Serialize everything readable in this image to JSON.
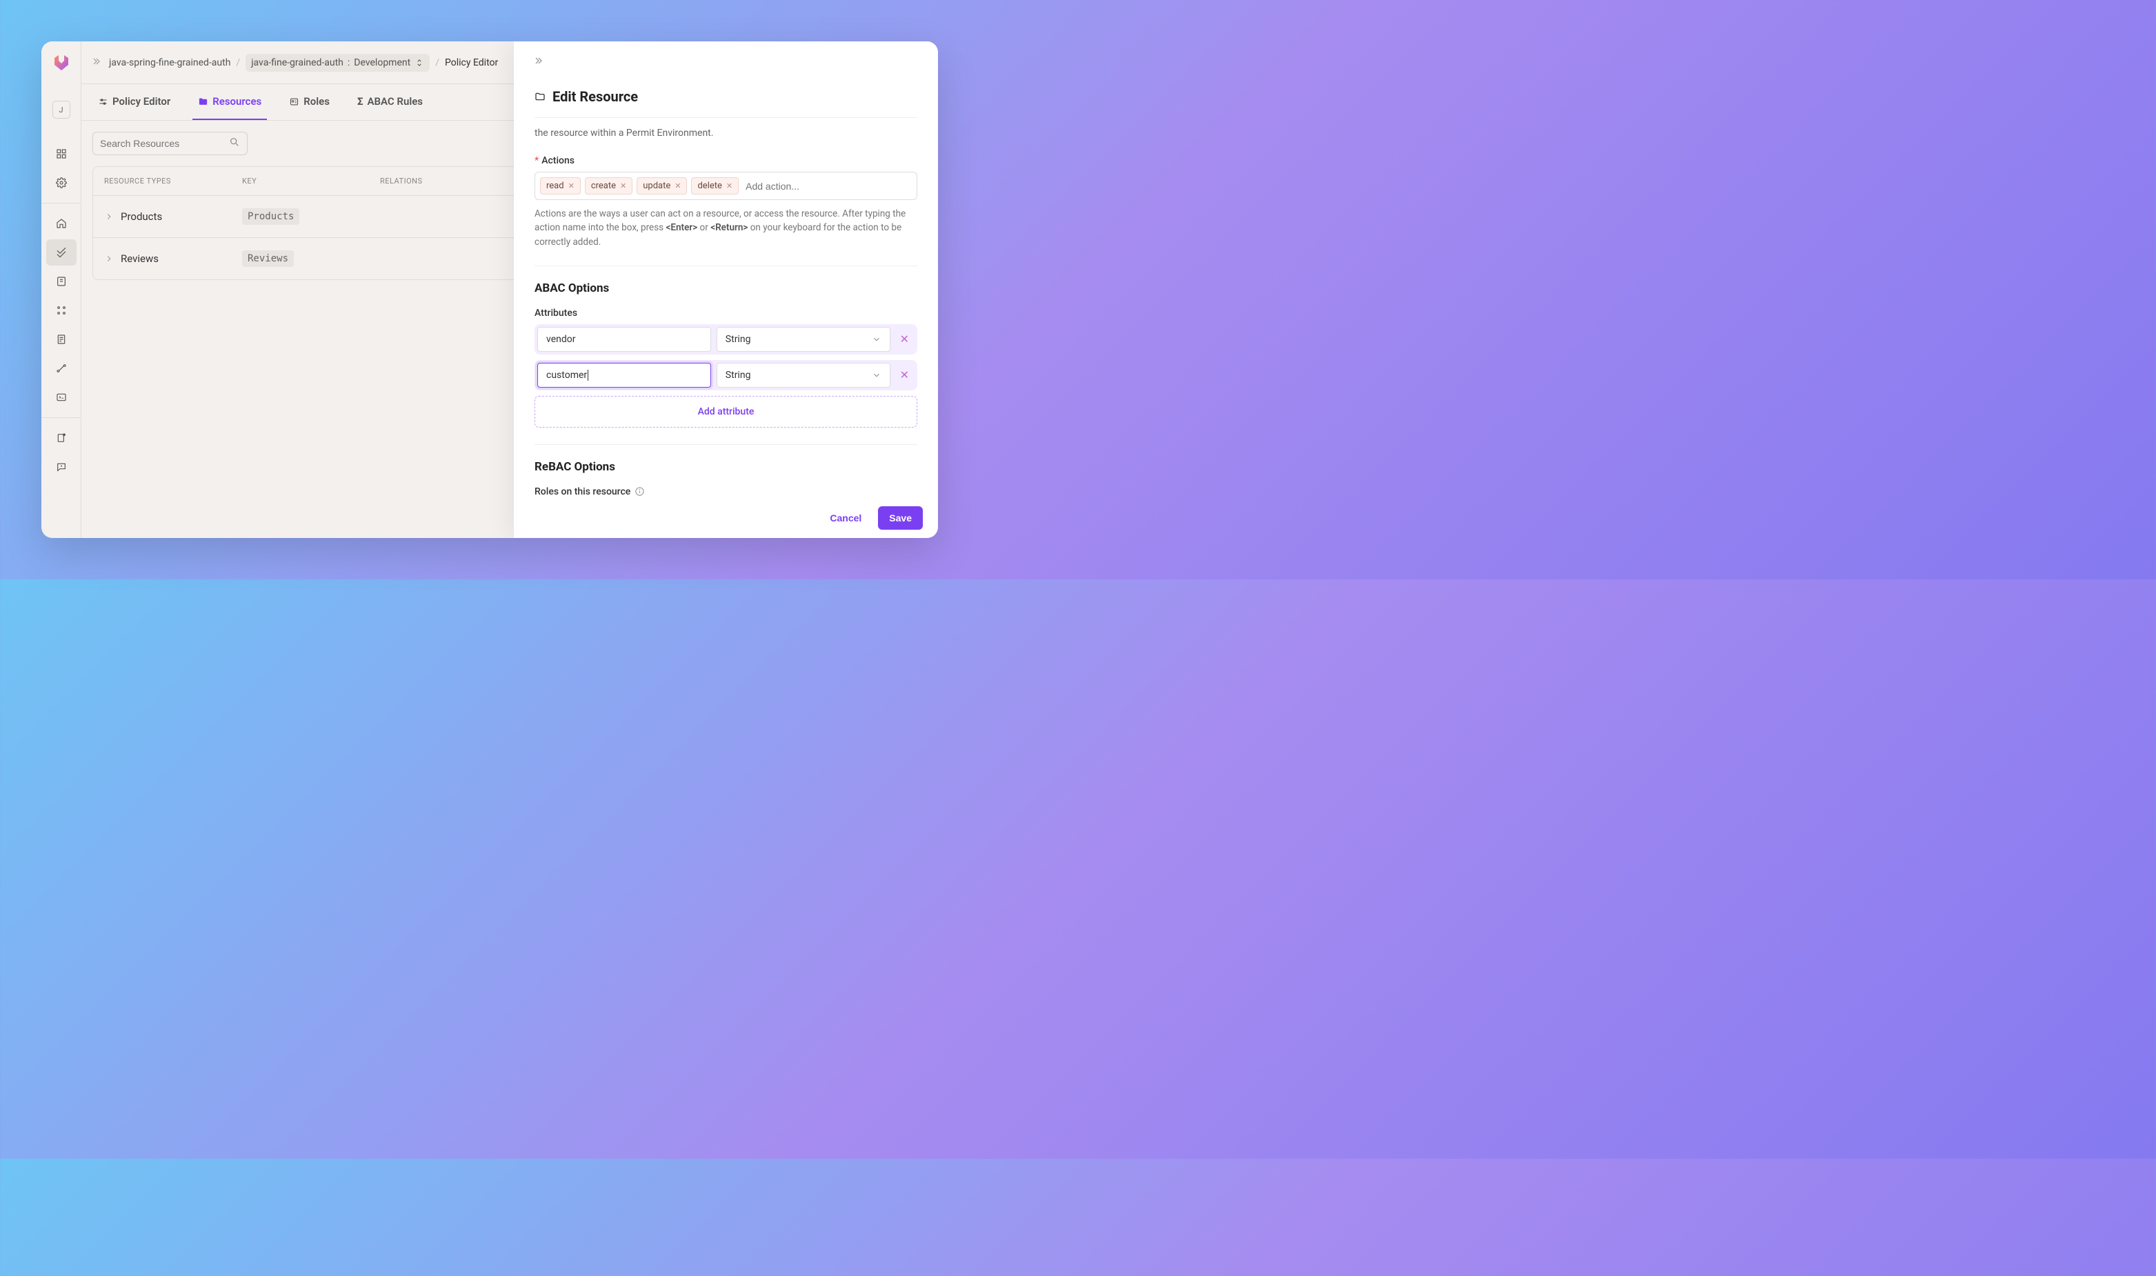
{
  "sidebar": {
    "avatar_letter": "J"
  },
  "breadcrumb": {
    "project": "java-spring-fine-grained-auth",
    "env_name": "java-fine-grained-auth",
    "env_stage": "Development",
    "current": "Policy Editor"
  },
  "tabs": {
    "policy_editor": "Policy Editor",
    "resources": "Resources",
    "roles": "Roles",
    "abac_rules": "ABAC Rules"
  },
  "search": {
    "placeholder": "Search Resources"
  },
  "table": {
    "col_types": "RESOURCE TYPES",
    "col_key": "KEY",
    "col_relations": "RELATIONS",
    "rows": [
      {
        "name": "Products",
        "key": "Products"
      },
      {
        "name": "Reviews",
        "key": "Reviews"
      }
    ]
  },
  "drawer": {
    "title": "Edit Resource",
    "subtitle": "the resource within a Permit Environment.",
    "actions_label": "Actions",
    "actions": [
      "read",
      "create",
      "update",
      "delete"
    ],
    "actions_placeholder": "Add action...",
    "actions_help_pre": "Actions are the ways a user can act on a resource, or access the resource. After typing the action name into the box, press ",
    "actions_help_enter": "<Enter>",
    "actions_help_or": " or ",
    "actions_help_return": "<Return>",
    "actions_help_post": " on your keyboard for the action to be correctly added.",
    "abac_title": "ABAC Options",
    "attributes_label": "Attributes",
    "attributes": [
      {
        "name": "vendor",
        "type": "String"
      },
      {
        "name": "customer",
        "type": "String"
      }
    ],
    "add_attr": "Add attribute",
    "rebac_title": "ReBAC Options",
    "roles_label": "Roles on this resource",
    "cancel": "Cancel",
    "save": "Save"
  }
}
